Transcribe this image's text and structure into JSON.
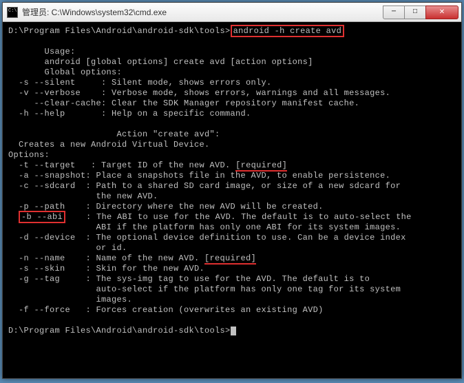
{
  "titlebar": {
    "text": "管理员: C:\\Windows\\system32\\cmd.exe"
  },
  "prompt1": {
    "path": "D:\\Program Files\\Android\\android-sdk\\tools>",
    "cmd": "android -h create avd"
  },
  "out": {
    "usage_h": "       Usage:",
    "usage_l": "       android [global options] create avd [action options]",
    "glob_h": "       Global options:",
    "s_sil": "  -s --silent     : Silent mode, shows errors only.",
    "v_ver": "  -v --verbose    : Verbose mode, shows errors, warnings and all messages.",
    "clear": "     --clear-cache: Clear the SDK Manager repository manifest cache.",
    "h_help": "  -h --help       : Help on a specific command.",
    "action_h": "                     Action \"create avd\":",
    "creates": "  Creates a new Android Virtual Device.",
    "opts_h": "Options:",
    "t_tgt_pre": "  -t --target   : Target ID of the new AVD. ",
    "t_tgt_req": "[required]",
    "a_snap": "  -a --snapshot: Place a snapshots file in the AVD, to enable persistence.",
    "c_sd1": "  -c --sdcard  : Path to a shared SD card image, or size of a new sdcard for",
    "c_sd2": "                 the new AVD.",
    "p_path": "  -p --path    : Directory where the new AVD will be created.",
    "b_abi_flag": "-b --abi",
    "b_abi_rest": "    : The ABI to use for the AVD. The default is to auto-select the",
    "b_abi2": "                 ABI if the platform has only one ABI for its system images.",
    "d_dev1": "  -d --device  : The optional device definition to use. Can be a device index",
    "d_dev2": "                 or id.",
    "n_name_pre": "  -n --name    : Name of the new AVD. ",
    "n_name_req": "[required]",
    "s_skin": "  -s --skin    : Skin for the new AVD.",
    "g_tag1": "  -g --tag     : The sys-img tag to use for the AVD. The default is to",
    "g_tag2": "                 auto-select if the platform has only one tag for its system",
    "g_tag3": "                 images.",
    "f_force": "  -f --force   : Forces creation (overwrites an existing AVD)"
  },
  "prompt2": {
    "path": "D:\\Program Files\\Android\\android-sdk\\tools>"
  }
}
